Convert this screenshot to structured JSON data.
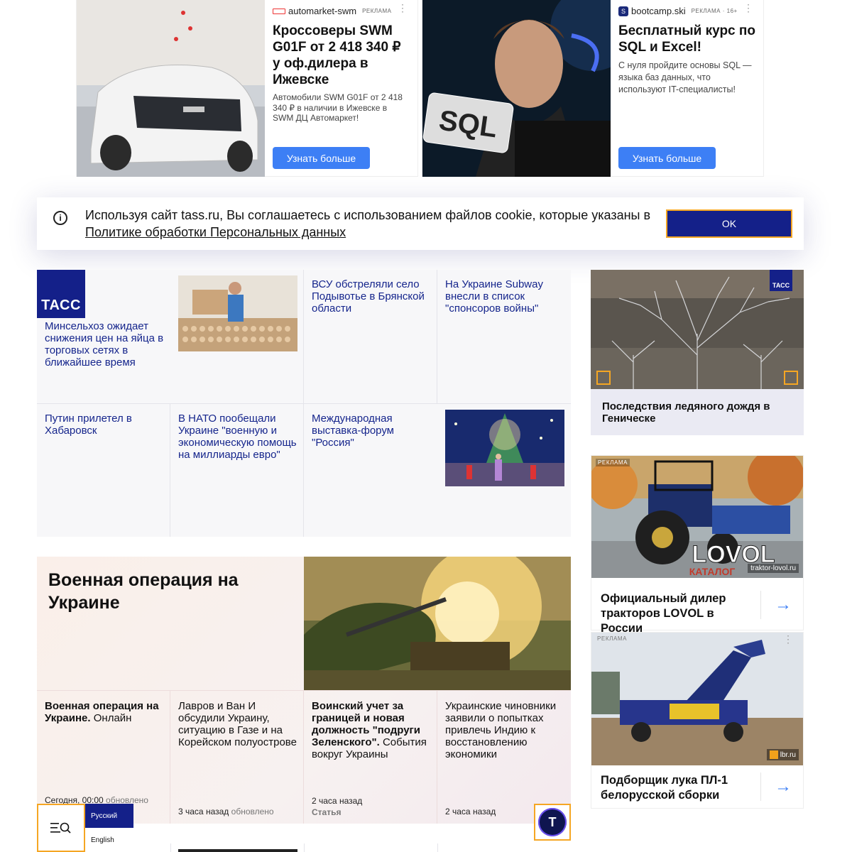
{
  "ads_top": [
    {
      "source": "automarket-swm",
      "tag": "РЕКЛАМА",
      "title": "Кроссоверы SWM G01F от 2 418 340 ₽ у оф.дилера в Ижевске",
      "desc": "Автомобили SWM G01F от 2 418 340 ₽ в наличии в Ижевске в SWM ДЦ Автомаркет!",
      "button": "Узнать больше"
    },
    {
      "source": "bootcamp.ski",
      "tag": "РЕКЛАМА · 16+",
      "title": "Бесплатный курс по SQL и Excel!",
      "desc": "С нуля пройдите основы SQL — языка баз данных, что используют IT-специалисты!",
      "button": "Узнать больше",
      "image_text": "SQL"
    }
  ],
  "cookie": {
    "text": "Используя сайт tass.ru, Вы соглашаетесь с использованием файлов cookie, которые указаны в ",
    "link": "Политике обработки Персональных данных",
    "ok": "OK"
  },
  "logo": "ТАСС",
  "news": [
    "Минсельхоз ожидает снижения цен на яйца в торговых сетях в ближайшее время",
    "ВСУ обстреляли село Подывотье в Брянской области",
    "На Украине Subway внесли в список \"спонсоров войны\"",
    "Путин прилетел в Хабаровск",
    "В НАТО пообещали Украине \"военную и экономическую помощь на миллиарды евро\"",
    "Международная выставка-форум \"Россия\""
  ],
  "photo_card": {
    "logo": "ТАСС",
    "caption": "Последствия ледяного дождя в Геническе"
  },
  "right_ads": [
    {
      "tag": "РЕКЛАМА",
      "image_brand": "LOVOL",
      "image_sub": "КАТАЛОГ",
      "domain": "traktor-lovol.ru",
      "title": "Официальный дилер тракторов LOVOL в России",
      "arrow": "→"
    },
    {
      "tag": "РЕКЛАМА",
      "domain": "lbr.ru",
      "title": "Подборщик лука ПЛ-1 белорусской сборки",
      "arrow": "→"
    }
  ],
  "military": {
    "title": "Военная операция на Украине",
    "items": [
      {
        "bold": "Военная операция на Украине.",
        "text": " Онлайн",
        "time": "Сегодня, 00:00",
        "extra": "обновлено"
      },
      {
        "bold": "",
        "text": "Лавров и Ван И обсудили Украину, ситуацию в Газе и на Корейском полуострове",
        "time": "3 часа назад",
        "extra": "обновлено"
      },
      {
        "bold": "Воинский учет за границей и новая должность \"подруги Зеленского\".",
        "text": " События вокруг Украины",
        "time": "2 часа назад",
        "extra": "Статья"
      },
      {
        "bold": "",
        "text": "Украинские чиновники заявили о попытках привлечь Индию к восстановлению экономики",
        "time": "2 часа назад",
        "extra": ""
      }
    ]
  },
  "bottom": {
    "lang_ru": "Русский",
    "lang_en": "English",
    "t_button": "T"
  }
}
